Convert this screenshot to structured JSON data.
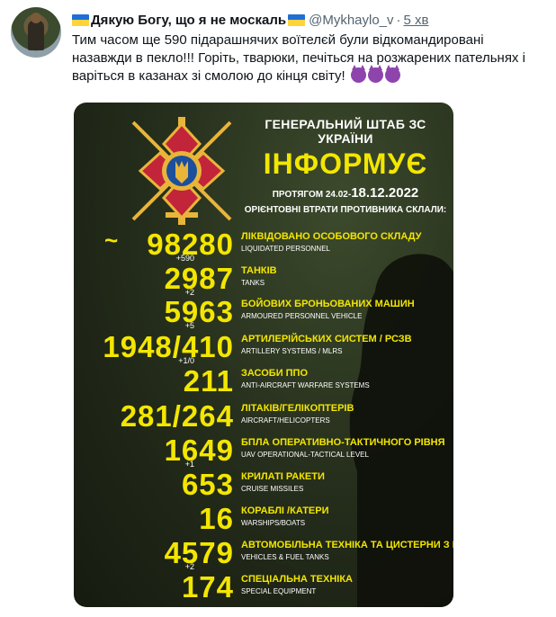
{
  "tweet": {
    "display_name": "Дякую Богу, що я не москаль",
    "handle": "@Mykhaylo_v",
    "separator": "·",
    "time": "5 хв",
    "text": "Тим часом ще 590 підарашнячих воїтелєй були відкомандировані назавжди в пекло!!! Горіть, тварюки, печіться на розжарених пательнях і варіться в казанах зі смолою до кінця світу!",
    "emoji": "smiling-devil-icon"
  },
  "infographic": {
    "title": "ГЕНЕРАЛЬНИЙ ШТАБ ЗС УКРАЇНИ",
    "headline": "ІНФОРМУЄ",
    "period_prefix": "ПРОТЯГОМ 24.02-",
    "period_end": "18.12.2022",
    "subtitle": "ОРІЄНТОВНІ ВТРАТИ ПРОТИВНИКА СКЛАЛИ:",
    "stats": [
      {
        "value": "98280",
        "tilde": "~",
        "increment": "+590",
        "label_ua": "ЛІКВІДОВАНО ОСОБОВОГО СКЛАДУ",
        "label_en": "LIQUIDATED PERSONNEL"
      },
      {
        "value": "2987",
        "increment": "+2",
        "label_ua": "ТАНКІВ",
        "label_en": "TANKS"
      },
      {
        "value": "5963",
        "increment": "+5",
        "label_ua": "БОЙОВИХ БРОНЬОВАНИХ МАШИН",
        "label_en": "ARMOURED PERSONNEL VEHICLE"
      },
      {
        "value": "1948/410",
        "increment": "+1/0",
        "label_ua": "АРТИЛЕРІЙСЬКИХ СИСТЕМ / РСЗВ",
        "label_en": "ARTILLERY SYSTEMS / MLRS"
      },
      {
        "value": "211",
        "increment": "",
        "label_ua": "ЗАСОБИ ППО",
        "label_en": "ANTI-AIRCRAFT WARFARE SYSTEMS"
      },
      {
        "value": "281/264",
        "increment": "",
        "label_ua": "ЛІТАКІВ/ГЕЛІКОПТЕРІВ",
        "label_en": "AIRCRAFT/HELICOPTERS"
      },
      {
        "value": "1649",
        "increment": "+1",
        "label_ua": "БПЛА ОПЕРАТИВНО-ТАКТИЧНОГО РІВНЯ",
        "label_en": "UAV OPERATIONAL-TACTICAL LEVEL"
      },
      {
        "value": "653",
        "increment": "",
        "label_ua": "КРИЛАТІ РАКЕТИ",
        "label_en": "CRUISE MISSILES"
      },
      {
        "value": "16",
        "increment": "",
        "label_ua": "КОРАБЛІ /КАТЕРИ",
        "label_en": "WARSHIPS/BOATS"
      },
      {
        "value": "4579",
        "increment": "+2",
        "label_ua": "АВТОМОБІЛЬНА ТЕХНІКА ТА ЦИСТЕРНИ З ПММ",
        "label_en": "VEHICLES & FUEL TANKS"
      },
      {
        "value": "174",
        "increment": "",
        "label_ua": "СПЕЦІАЛЬНА ТЕХНІКА",
        "label_en": "SPECIAL EQUIPMENT"
      }
    ]
  },
  "colors": {
    "accent_yellow": "#f3e600",
    "muted": "#536471"
  }
}
